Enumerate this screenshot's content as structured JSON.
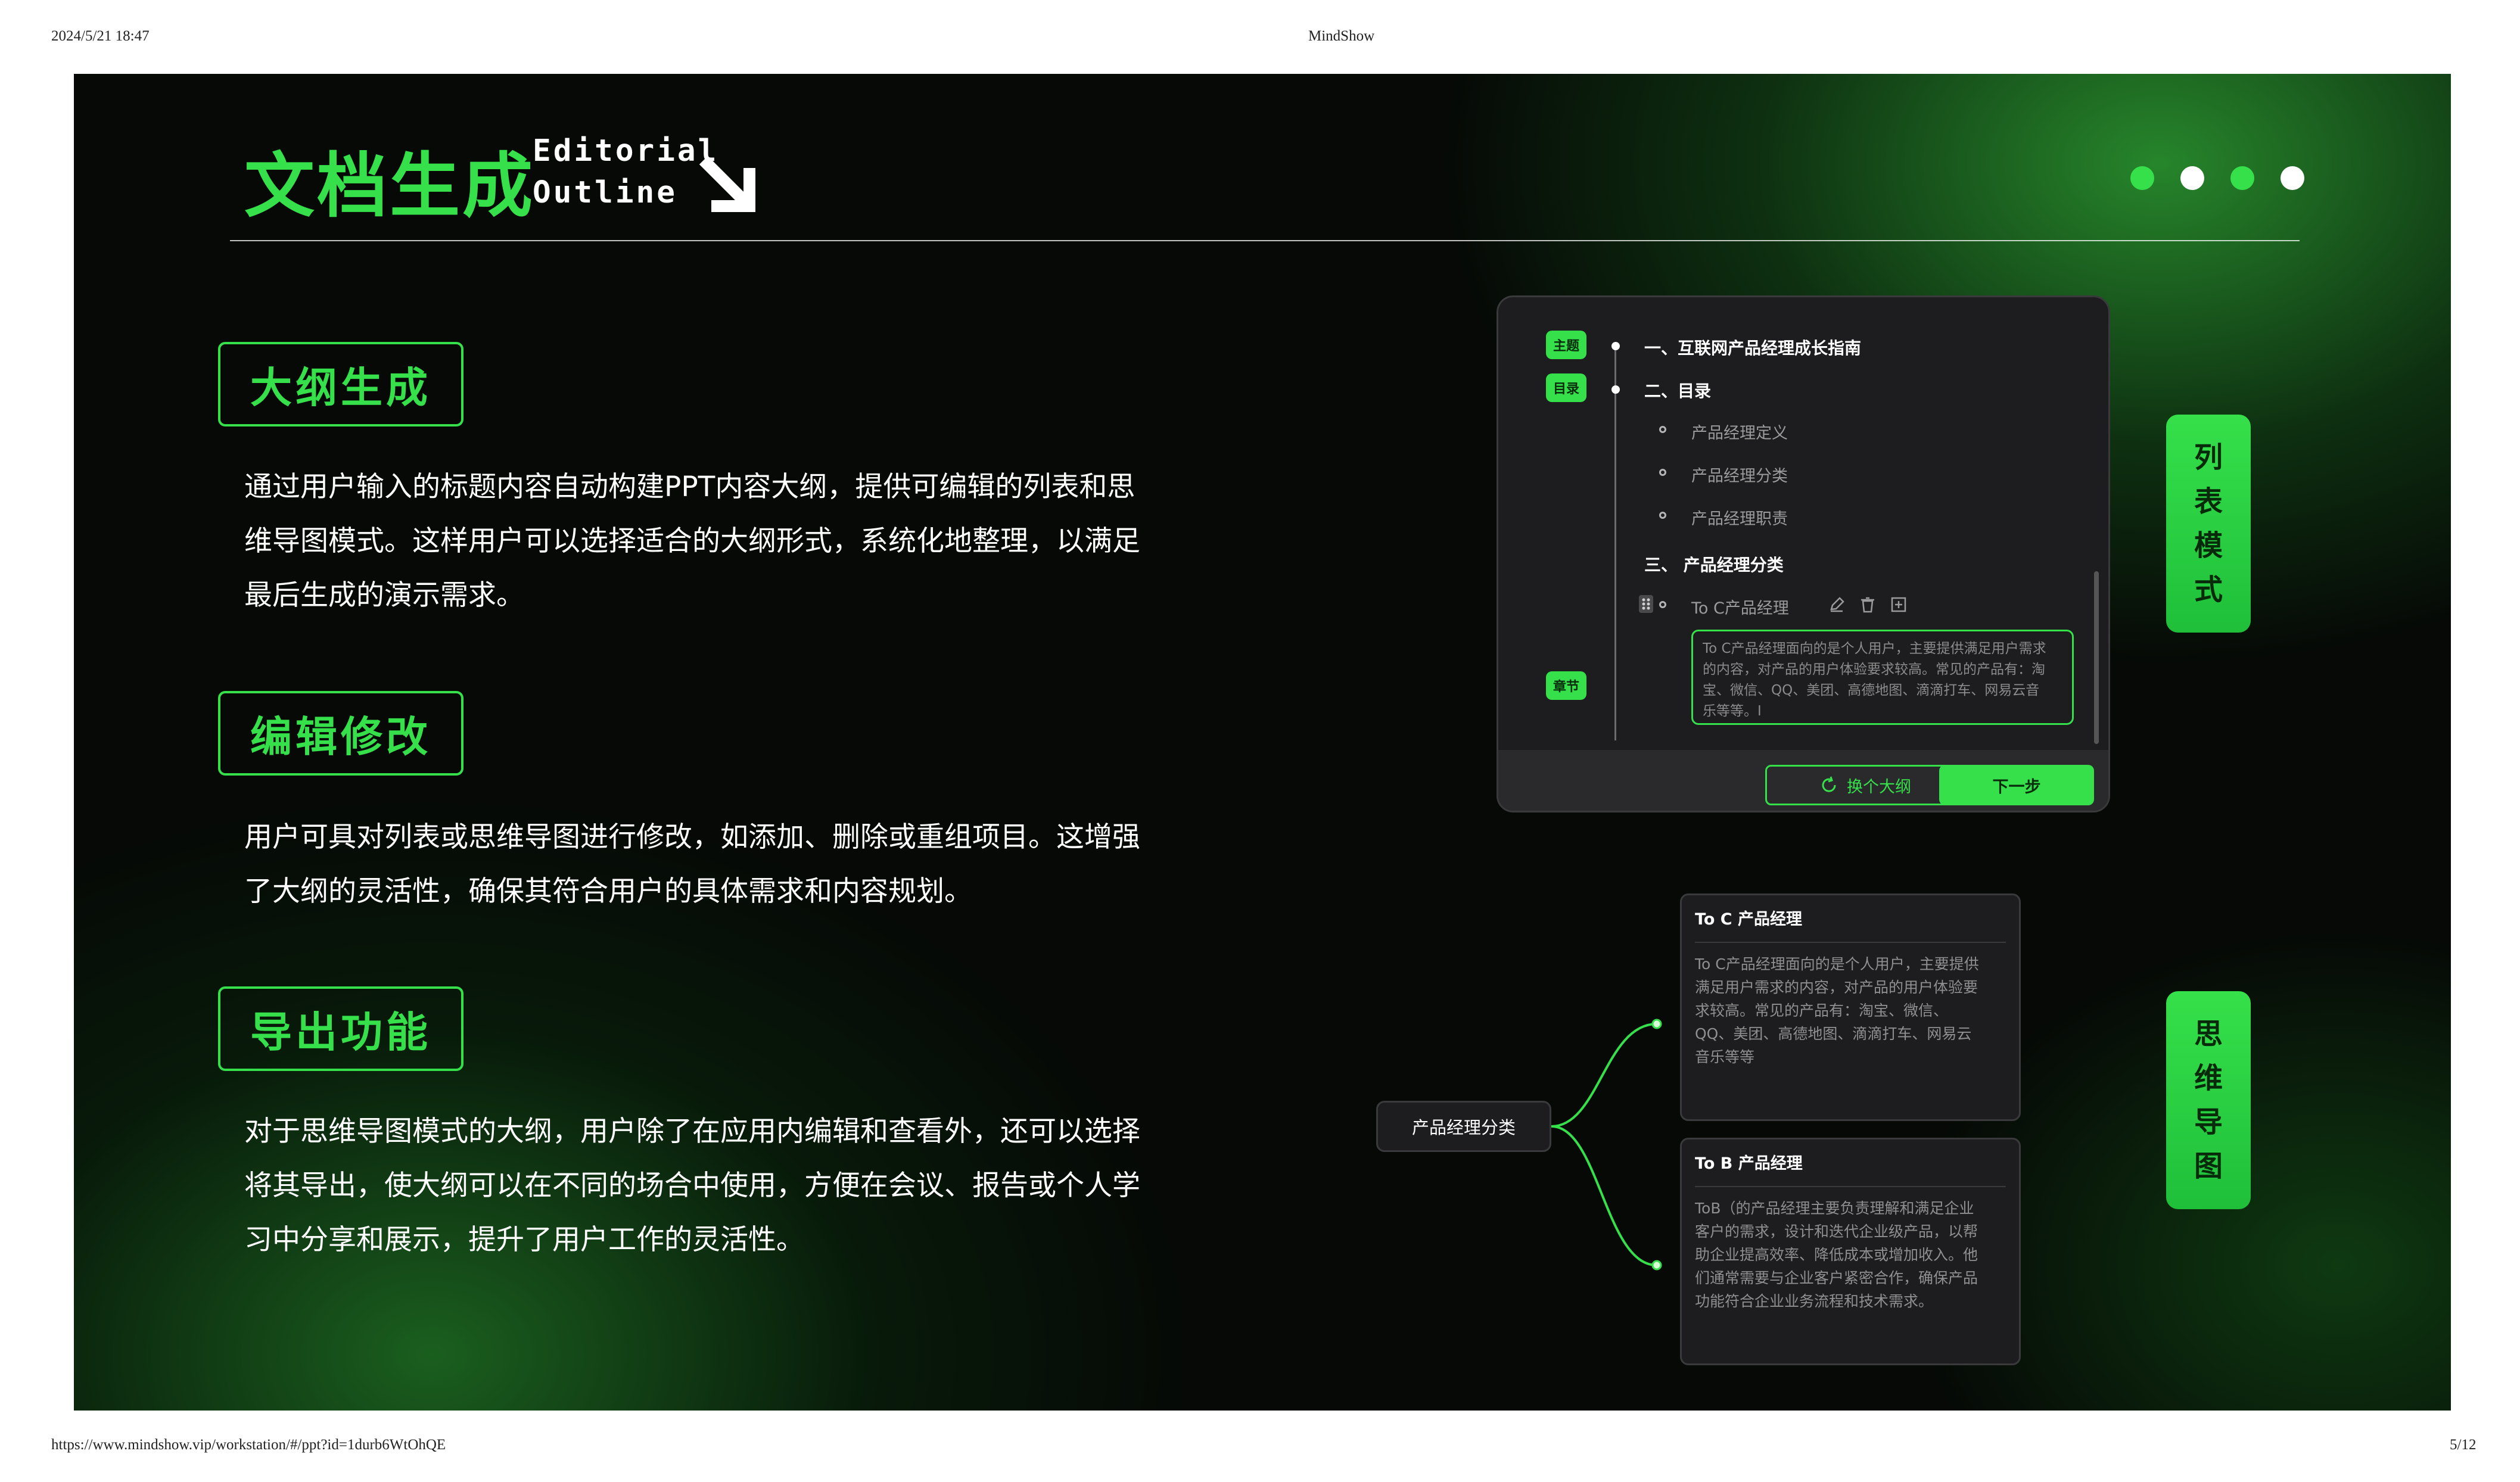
{
  "print_header": {
    "datetime": "2024/5/21 18:47",
    "site_title": "MindShow",
    "url": "https://www.mindshow.vip/workstation/#/ppt?id=1durb6WtOhQE",
    "page": "5/12"
  },
  "slide": {
    "title_cn": "文档生成",
    "title_en_line1": "Editorial",
    "title_en_line2": "Outline",
    "accent_color": "#35e04a",
    "nav_dots": [
      "green",
      "white",
      "green",
      "white"
    ],
    "sections": [
      {
        "heading": "大纲生成",
        "lines": [
          "通过用户输入的标题内容自动构建PPT内容大纲，提供可编辑的列表和思",
          "维导图模式。这样用户可以选择适合的大纲形式，系统化地整理，以满足",
          "最后生成的演示需求。"
        ]
      },
      {
        "heading": "编辑修改",
        "lines": [
          "用户可具对列表或思维导图进行修改，如添加、删除或重组项目。这增强",
          "了大纲的灵活性，确保其符合用户的具体需求和内容规划。"
        ]
      },
      {
        "heading": "导出功能",
        "lines": [
          "对于思维导图模式的大纲，用户除了在应用内编辑和查看外，还可以选择",
          "将其导出，使大纲可以在不同的场合中使用，方便在会议、报告或个人学",
          "习中分享和展示，提升了用户工作的灵活性。"
        ]
      }
    ],
    "list_panel": {
      "tag_theme": "主题",
      "tag_catalog": "目录",
      "tag_chapter": "章节",
      "item1": "一、互联网产品经理成长指南",
      "item2": "二、目录",
      "sub1": "产品经理定义",
      "sub2": "产品经理分类",
      "sub3": "产品经理职责",
      "item3": "三、 产品经理分类",
      "editing_item": "To C产品经理",
      "textarea_lines": [
        "To C产品经理面向的是个人用户，主要提供满足用户需求",
        "的内容，对产品的用户体验要求较高。常见的产品有：淘",
        "宝、微信、QQ、美团、高德地图、滴滴打车、网易云音",
        "乐等等。I"
      ],
      "btn_change": "换个大纲",
      "btn_next": "下一步"
    },
    "label_list_mode": [
      "列",
      "表",
      "模",
      "式"
    ],
    "label_mindmap": [
      "思",
      "维",
      "导",
      "图"
    ],
    "mindmap": {
      "root": "产品经理分类",
      "card1_title": "To C 产品经理",
      "card1_lines": [
        "To C产品经理面向的是个人用户，主要提供",
        "满足用户需求的内容，对产品的用户体验要",
        "求较高。常见的产品有：淘宝、微信、",
        "QQ、美团、高德地图、滴滴打车、网易云",
        "音乐等等"
      ],
      "card2_title": "To B 产品经理",
      "card2_lines": [
        "ToB（的产品经理主要负责理解和满足企业",
        "客户的需求，设计和迭代企业级产品，以帮",
        "助企业提高效率、降低成本或增加收入。他",
        "们通常需要与企业客户紧密合作，确保产品",
        "功能符合企业业务流程和技术需求。"
      ]
    }
  }
}
